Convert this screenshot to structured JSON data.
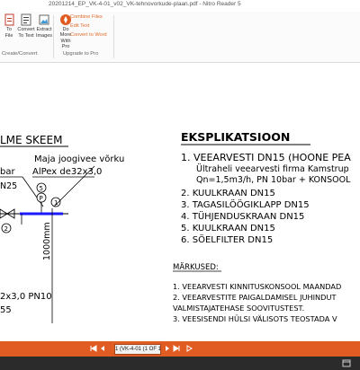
{
  "window": {
    "title": "20201214_EP_VK-4-01_v02_VK-tehnovorkude-plaan.pdf - Nitro Reader 5"
  },
  "ribbon": {
    "buttons": [
      {
        "line1": "To",
        "line2": "File"
      },
      {
        "line1": "Convert",
        "line2": "To Text"
      },
      {
        "line1": "Extract",
        "line2": "Images"
      },
      {
        "line1": "Do More",
        "line2": "With Pro"
      }
    ],
    "groups": {
      "create_convert": "Create/Convert",
      "upgrade": "Upgrade to Pro"
    },
    "upgrade_links": [
      "Combine Files",
      "Edit Text",
      "Convert to Word"
    ]
  },
  "drawing": {
    "left_title": "LME  SKEEM",
    "pipe_label_1": "Maja  joogivee  võrku",
    "pipe_label_2": "AlPex  de32x3,0",
    "bar_label": "bar",
    "n25_label": "N25",
    "height_label": "1000mm",
    "pipe_bottom_1": "2x3,0  PN10",
    "pipe_bottom_2": "55",
    "callout_2": "2",
    "callout_5": "5",
    "callout_p": "P",
    "callout_1": "1",
    "expl_title": "EKSPLIKATSIOON",
    "items": [
      "1.  VEEARVESTI  DN15  (HOONE PEA",
      "Ültraheli veearvesti firma Kamstrup",
      "Qn=1,5m3/h, PN 10bar + KONSOOL",
      "2.  KUULKRAAN  DN15",
      "3.  TAGASILÖÖGIKLAPP DN15",
      "4.  TÜHJENDUSKRAAN  DN15",
      "5.  KUULKRAAN  DN15",
      "6.  SÖELFILTER  DN15"
    ],
    "notes_title": "MÄRKUSED:",
    "notes": [
      "1. VEEARVESTI KINNITUSKONSOOL MAANDAD",
      "2. VEEARVESTITE PAIGALDAMISEL JUHINDUT",
      "VALMISTAJATEHASE SOOVITUSTEST.",
      "3. VEESISENDI HÜLSI VÄLISOTS TEOSTADA V"
    ]
  },
  "statusbar": {
    "page_indicator": "1 (VK-4-01 (1 OF 1)"
  },
  "colors": {
    "accent": "#e05c23",
    "pipe_blue": "#1a1aff",
    "link_orange": "#e06b2c"
  }
}
